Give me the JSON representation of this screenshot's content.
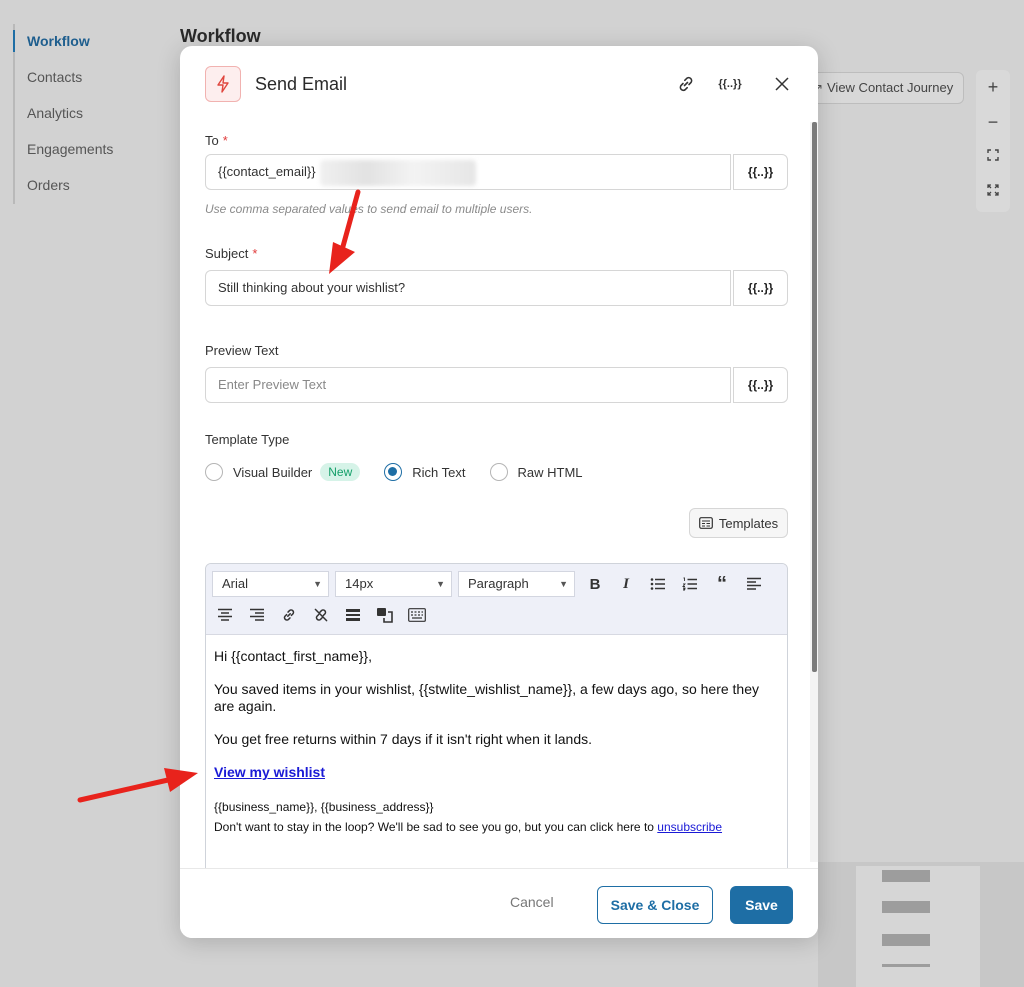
{
  "sidebar": {
    "items": [
      {
        "label": "Workflow",
        "active": true
      },
      {
        "label": "Contacts"
      },
      {
        "label": "Analytics"
      },
      {
        "label": "Engagements"
      },
      {
        "label": "Orders"
      }
    ]
  },
  "page": {
    "title": "Workflow",
    "journey_button": "View Contact Journey",
    "zoom": {
      "in": "+",
      "out": "−"
    }
  },
  "modal": {
    "title": "Send Email",
    "icons": {
      "action": "lightning-icon",
      "link": "link-icon",
      "merge": "merge-tag-icon",
      "close": "close-icon"
    },
    "to": {
      "label": "To",
      "required_mark": "*",
      "value": "{{contact_email}}",
      "merge_label": "{{..}}",
      "help": "Use comma separated values to send email to multiple users."
    },
    "subject": {
      "label": "Subject",
      "required_mark": "*",
      "value": "Still thinking about your wishlist?",
      "merge_label": "{{..}}"
    },
    "preview_text": {
      "label": "Preview Text",
      "placeholder": "Enter Preview Text",
      "merge_label": "{{..}}"
    },
    "template_type": {
      "label": "Template Type",
      "options": [
        {
          "label": "Visual Builder",
          "badge": "New",
          "selected": false
        },
        {
          "label": "Rich Text",
          "selected": true
        },
        {
          "label": "Raw HTML",
          "selected": false
        }
      ]
    },
    "templates_button": "Templates",
    "editor": {
      "font": "Arial",
      "size": "14px",
      "block": "Paragraph",
      "body": {
        "greeting": "Hi {{contact_first_name}},",
        "line1": "You saved items in your wishlist, {{stwlite_wishlist_name}}, a few days ago, so here they are again.",
        "line2": "You get free returns within 7 days if it isn't right when it lands.",
        "link": "View my wishlist",
        "business": "{{business_name}}, {{business_address}}",
        "unsub_text": "Don't want to stay in the loop? We'll be sad to see you go, but you can click here to ",
        "unsub_link": "unsubscribe"
      }
    },
    "footer": {
      "cancel": "Cancel",
      "save_close": "Save & Close",
      "save": "Save"
    }
  },
  "colors": {
    "primary": "#1e6ea5",
    "required": "#e03a3a",
    "badge_bg": "#d6f3e8",
    "badge_text": "#15a06a",
    "arrow": "#e8231c"
  }
}
